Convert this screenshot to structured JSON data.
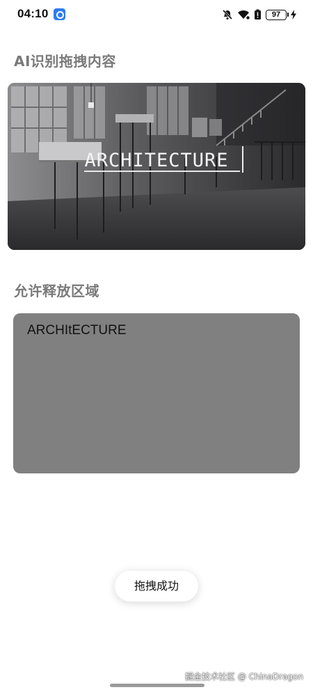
{
  "status_bar": {
    "time": "04:10",
    "battery_level": "97",
    "icons": [
      "app-notification-icon",
      "mute-bell-icon",
      "wifi-icon",
      "battery-alert-icon",
      "battery-icon",
      "charging-icon"
    ]
  },
  "drag_section": {
    "title": "AI识别拖拽内容",
    "image": {
      "caption": "ARCHITECTURE"
    }
  },
  "drop_section": {
    "title": "允许释放区域",
    "dropped_text": "ARCHItECTURE"
  },
  "toast": {
    "text": "拖拽成功"
  },
  "watermark": {
    "text": "掘金技术社区 @ ChinaDragon"
  },
  "colors": {
    "drop_zone_bg": "#808080",
    "section_title": "#7a7a7a",
    "status_app_icon": "#2f7bf0"
  }
}
